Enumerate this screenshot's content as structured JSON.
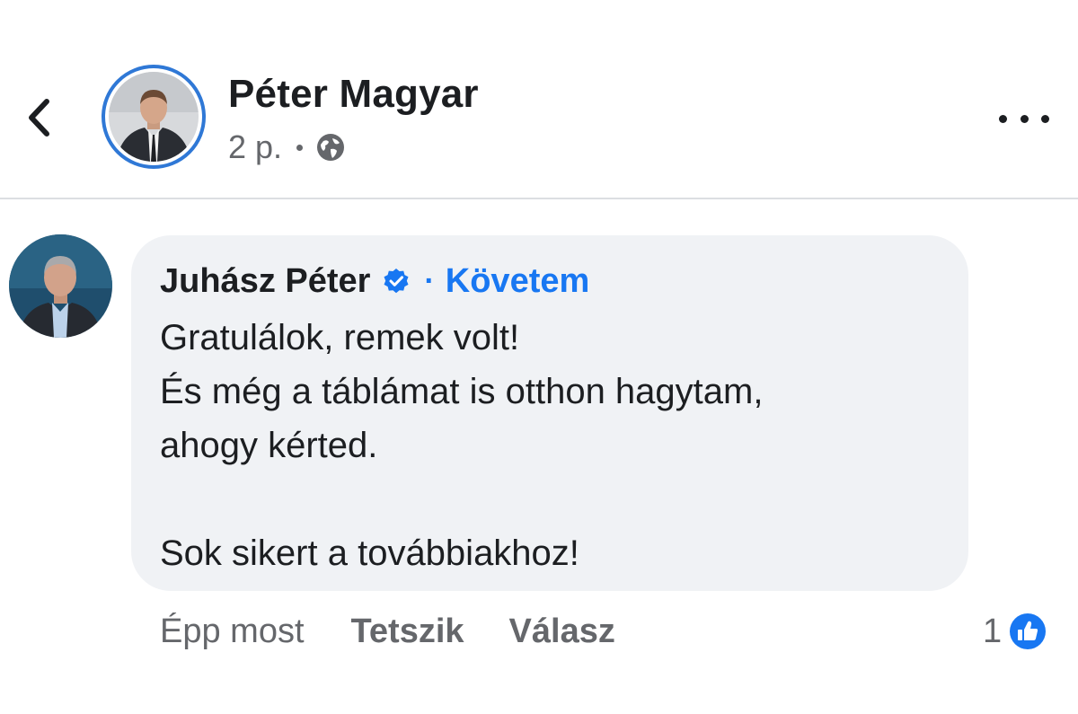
{
  "header": {
    "back_icon": "chevron-left-icon",
    "author_name": "Péter Magyar",
    "post_time": "2 p.",
    "audience_icon": "globe-icon",
    "more_icon": "more-horizontal-icon",
    "avatar_ring_color": "#2f78d6"
  },
  "comment": {
    "author_name": "Juhász Péter",
    "verified_icon": "verified-badge-icon",
    "follow_separator": "·",
    "follow_label": "Követem",
    "lines": [
      "Gratulálok, remek volt!",
      "És még a táblámat is otthon hagytam,",
      "ahogy kérted.",
      "Sok sikert a továbbiakhoz!"
    ],
    "time": "Épp most",
    "like_label": "Tetszik",
    "reply_label": "Válasz",
    "reaction_count": "1",
    "reaction_icon": "like-reaction-icon"
  },
  "colors": {
    "accent": "#1877f2",
    "secondary_text": "#65676b",
    "bubble_bg": "#f0f2f5",
    "primary_text": "#1c1e21"
  }
}
